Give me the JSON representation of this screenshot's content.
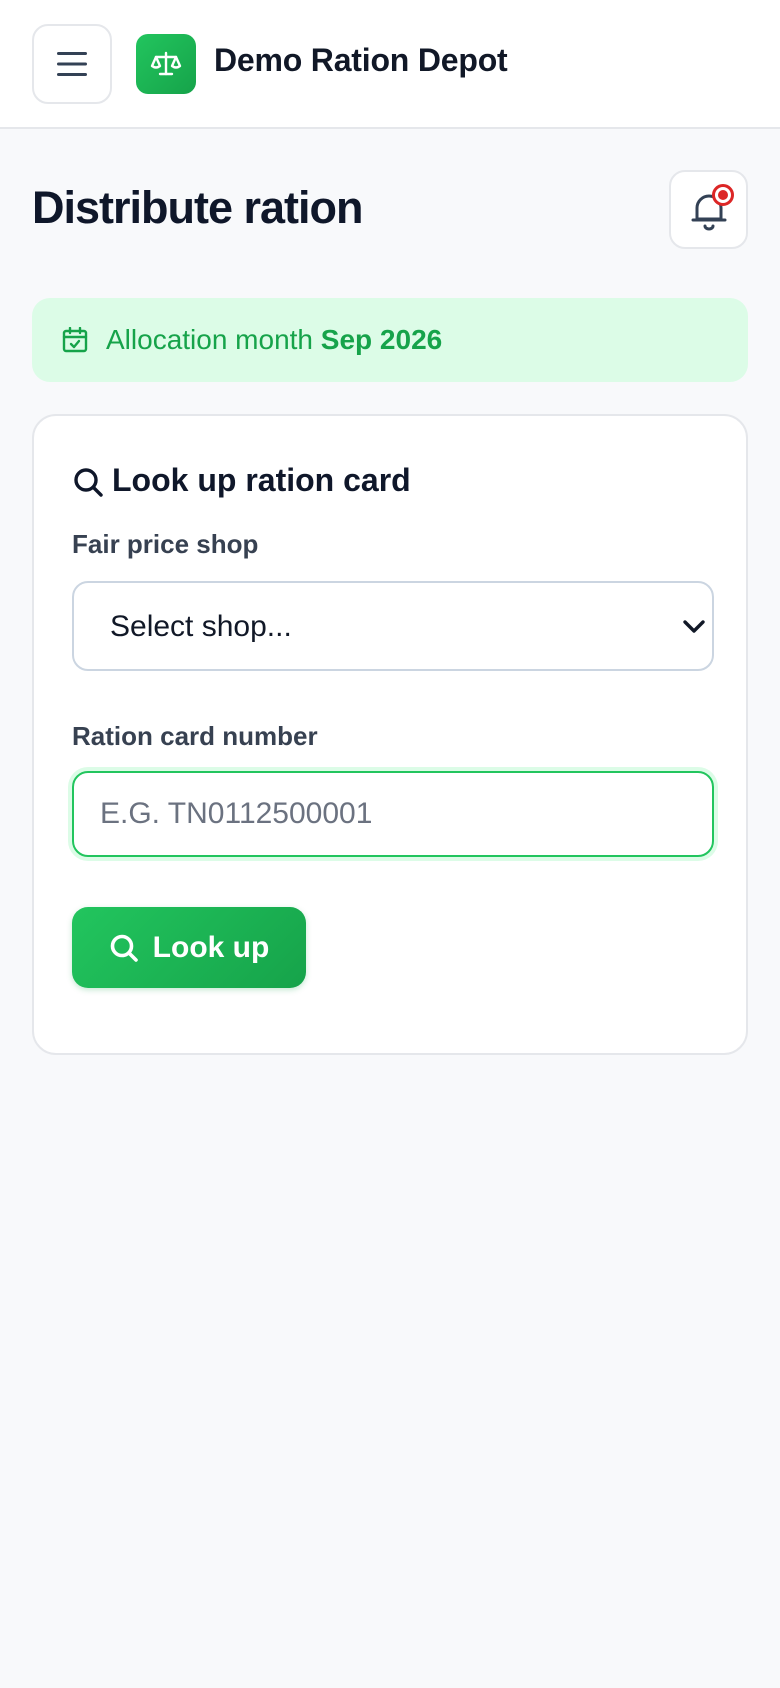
{
  "header": {
    "app_title": "Demo Ration Depot",
    "menu_icon": "hamburger-menu-icon",
    "logo_icon": "scales-icon"
  },
  "page": {
    "title": "Distribute ration",
    "notification_icon": "bell-icon"
  },
  "allocation": {
    "label": "Allocation month",
    "month": "Sep 2026",
    "icon": "calendar-check-icon"
  },
  "lookup": {
    "title": "Look up ration card",
    "title_icon": "search-icon",
    "shop_label": "Fair price shop",
    "shop_selected": "Select shop...",
    "card_label": "Ration card number",
    "card_placeholder": "E.G. TN0112500001",
    "card_value": "",
    "button_label": "Look up"
  },
  "colors": {
    "accent": "#22c55e",
    "accent_dark": "#16a34a",
    "alert": "#dc2626",
    "banner_bg": "#dcfce7"
  }
}
